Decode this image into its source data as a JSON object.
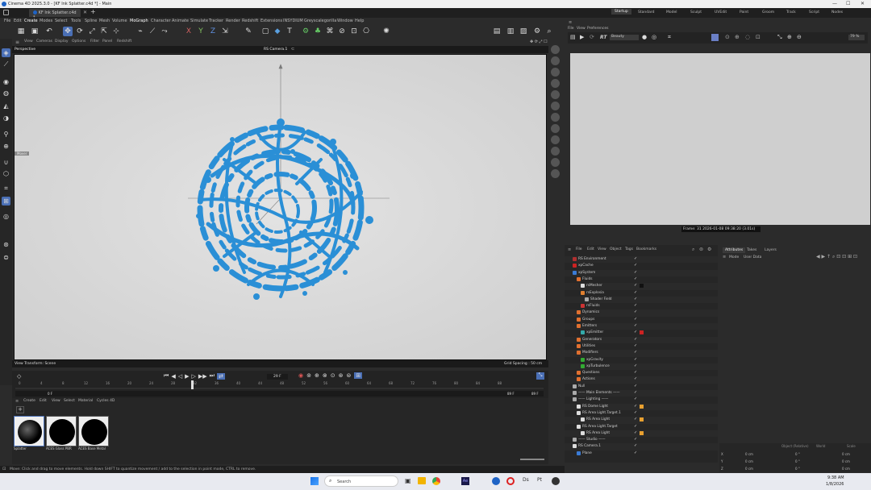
{
  "window": {
    "title": "Cinema 4D 2025.3.0 - [KF Ink Splatter.c4d *] - Main",
    "min": "—",
    "max": "☐",
    "close": "✕"
  },
  "doc_tab": {
    "label": "KF Ink Splatter.c4d *",
    "close": "✕",
    "add": "+"
  },
  "menu": [
    "File",
    "Edit",
    "Create",
    "Modes",
    "Select",
    "Tools",
    "Spline",
    "Mesh",
    "Volume",
    "MoGraph",
    "Character",
    "Animate",
    "Simulate",
    "Tracker",
    "Render",
    "Redshift",
    "Extensions",
    "INSYDIUM",
    "Greyscalegorilla",
    "Window",
    "Help"
  ],
  "layout_tabs": [
    "Startup",
    "Standard",
    "Model",
    "Sculpt",
    "UVEdit",
    "Paint",
    "Groom",
    "Track",
    "Script",
    "Nodes"
  ],
  "viewport": {
    "menu": [
      "View",
      "Cameras",
      "Display",
      "Options",
      "Filter",
      "Panel",
      "Redshift"
    ],
    "name": "Perspective",
    "camera": "RS Camera.1",
    "footer_left": "View Transform: Scene",
    "footer_right": "Grid Spacing : 50 cm"
  },
  "rv": {
    "menu": [
      "File",
      "View",
      "Preferences"
    ],
    "rt": "RT",
    "mode": "Beauty",
    "zoom": "79 %",
    "info": "Frame: 31  2026-01-08  09:38:20  (3.01s)"
  },
  "timeline": {
    "frame": "29 F",
    "start": "0 F",
    "end": "89 F",
    "end2": "89 F",
    "ruler": [
      "0",
      "4",
      "8",
      "12",
      "16",
      "20",
      "24",
      "28",
      "32",
      "36",
      "40",
      "44",
      "48",
      "52",
      "56",
      "60",
      "64",
      "68",
      "72",
      "76",
      "80",
      "84",
      "88"
    ]
  },
  "assets": {
    "menu": [
      "Create",
      "Edit",
      "View",
      "Select",
      "Material",
      "Cycles 4D"
    ],
    "items": [
      {
        "label": "Splatter"
      },
      {
        "label": "ACES Glass PBR"
      },
      {
        "label": "ACES Base Metal"
      }
    ]
  },
  "status": "Move: Click and drag to move elements. Hold down SHIFT to quantize movement / add to the selection in point mode, CTRL to remove.",
  "objects": {
    "menu": [
      "File",
      "Edit",
      "View",
      "Object",
      "Tags",
      "Bookmarks"
    ],
    "rows": [
      {
        "name": "RS Environment",
        "indent": 0,
        "color": "#b03030",
        "tag": ""
      },
      {
        "name": "xpCache",
        "indent": 0,
        "color": "#c22",
        "tag": ""
      },
      {
        "name": "xpSystem",
        "indent": 0,
        "color": "#3a7bd5",
        "tag": ""
      },
      {
        "name": "Fluids",
        "indent": 1,
        "color": "#e07030",
        "tag": ""
      },
      {
        "name": "rsMesher",
        "indent": 2,
        "color": "#ddd",
        "tag": "#111"
      },
      {
        "name": "rsExplosia",
        "indent": 2,
        "color": "#e08030",
        "tag": ""
      },
      {
        "name": "Shader Field",
        "indent": 3,
        "color": "#aaa",
        "tag": ""
      },
      {
        "name": "rsFluids",
        "indent": 2,
        "color": "#c33",
        "tag": ""
      },
      {
        "name": "Dynamics",
        "indent": 1,
        "color": "#e07030",
        "tag": ""
      },
      {
        "name": "Groups",
        "indent": 1,
        "color": "#e07030",
        "tag": ""
      },
      {
        "name": "Emitters",
        "indent": 1,
        "color": "#e07030",
        "tag": ""
      },
      {
        "name": "xpEmitter",
        "indent": 2,
        "color": "#3aa",
        "tag": "#c22"
      },
      {
        "name": "Generators",
        "indent": 1,
        "color": "#e07030",
        "tag": ""
      },
      {
        "name": "Utilities",
        "indent": 1,
        "color": "#e07030",
        "tag": ""
      },
      {
        "name": "Modifiers",
        "indent": 1,
        "color": "#e07030",
        "tag": ""
      },
      {
        "name": "xpGravity",
        "indent": 2,
        "color": "#3a3",
        "tag": ""
      },
      {
        "name": "xpTurbulence",
        "indent": 2,
        "color": "#3a3",
        "tag": ""
      },
      {
        "name": "Questions",
        "indent": 1,
        "color": "#e07030",
        "tag": ""
      },
      {
        "name": "Actions",
        "indent": 1,
        "color": "#e07030",
        "tag": ""
      },
      {
        "name": "Null",
        "indent": 0,
        "color": "#aaa",
        "tag": ""
      },
      {
        "name": "—— Main Elements ——",
        "indent": 0,
        "color": "#aaa",
        "tag": ""
      },
      {
        "name": "—— Lighting ——",
        "indent": 0,
        "color": "#aaa",
        "tag": ""
      },
      {
        "name": "RS Dome Light",
        "indent": 1,
        "color": "#ddd",
        "tag": "#e8a030"
      },
      {
        "name": "RS Area Light.Target.1",
        "indent": 1,
        "color": "#ddd",
        "tag": ""
      },
      {
        "name": "RS Area Light",
        "indent": 2,
        "color": "#ddd",
        "tag": "#e8a030"
      },
      {
        "name": "RS Area Light.Target",
        "indent": 1,
        "color": "#ddd",
        "tag": ""
      },
      {
        "name": "RS Area Light",
        "indent": 2,
        "color": "#ddd",
        "tag": "#e8a030"
      },
      {
        "name": "—— Studio ——",
        "indent": 0,
        "color": "#aaa",
        "tag": ""
      },
      {
        "name": "RS Camera.1",
        "indent": 0,
        "color": "#ddd",
        "tag": ""
      },
      {
        "name": "Plane",
        "indent": 1,
        "color": "#3a7bd5",
        "tag": ""
      }
    ]
  },
  "attributes": {
    "tabs": [
      "Attributes",
      "Takes",
      "Layers"
    ],
    "submenu": [
      "Mode",
      "User Data"
    ]
  },
  "coords": {
    "headers": [
      "Object (Relative)",
      "World",
      "Scale"
    ],
    "rows": [
      {
        "axis": "X",
        "a": "0 cm",
        "b": "0 °",
        "c": "0 cm"
      },
      {
        "axis": "Y",
        "a": "0 cm",
        "b": "0 °",
        "c": "0 cm"
      },
      {
        "axis": "Z",
        "a": "0 cm",
        "b": "0 °",
        "c": "0 cm"
      }
    ]
  },
  "taskbar": {
    "search": "Search",
    "time": "9:38 AM",
    "date": "1/8/2026"
  },
  "colors": {
    "accent": "#4a6fb5",
    "splatter": "#2a8fd6"
  }
}
